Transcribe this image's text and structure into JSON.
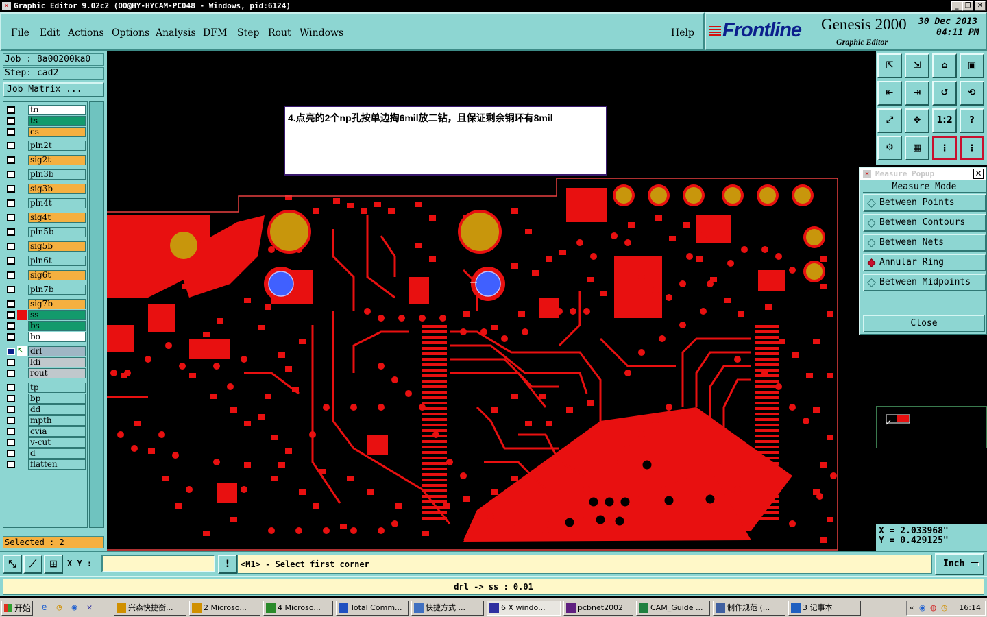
{
  "window": {
    "title": "Graphic Editor 9.02c2  (OO@HY-HYCAM-PC048 - Windows, pid:6124)"
  },
  "menu": {
    "file": "File",
    "edit": "Edit",
    "actions": "Actions",
    "options": "Options",
    "analysis": "Analysis",
    "dfm": "DFM",
    "step": "Step",
    "rout": "Rout",
    "windows": "Windows",
    "help": "Help"
  },
  "brand": {
    "logo": "Frontline",
    "product": "Genesis 2000",
    "subtitle": "Graphic Editor",
    "date_line1": "30  Dec  2013",
    "date_line2": "04:11  PM"
  },
  "left": {
    "job": "Job  :  8a00200ka0",
    "step": "Step:  cad2",
    "job_matrix": "Job Matrix ...",
    "selected": "Selected : 2"
  },
  "layers": [
    {
      "name": "to",
      "bg": "#ffffff",
      "swatch": ""
    },
    {
      "name": "ts",
      "bg": "#139a6c",
      "swatch": ""
    },
    {
      "name": "cs",
      "bg": "#f5b040",
      "swatch": ""
    },
    {
      "name": "pln2t",
      "bg": "#8dd6d2",
      "swatch": ""
    },
    {
      "name": "sig2t",
      "bg": "#f5b040",
      "swatch": ""
    },
    {
      "name": "pln3b",
      "bg": "#8dd6d2",
      "swatch": ""
    },
    {
      "name": "sig3b",
      "bg": "#f5b040",
      "swatch": ""
    },
    {
      "name": "pln4t",
      "bg": "#8dd6d2",
      "swatch": ""
    },
    {
      "name": "sig4t",
      "bg": "#f5b040",
      "swatch": ""
    },
    {
      "name": "pln5b",
      "bg": "#8dd6d2",
      "swatch": ""
    },
    {
      "name": "sig5b",
      "bg": "#f5b040",
      "swatch": ""
    },
    {
      "name": "pln6t",
      "bg": "#8dd6d2",
      "swatch": ""
    },
    {
      "name": "sig6t",
      "bg": "#f5b040",
      "swatch": ""
    },
    {
      "name": "pln7b",
      "bg": "#8dd6d2",
      "swatch": ""
    },
    {
      "name": "sig7b",
      "bg": "#f5b040",
      "swatch": ""
    },
    {
      "name": "ss",
      "bg": "#139a6c",
      "swatch": "#e81010"
    },
    {
      "name": "bs",
      "bg": "#139a6c",
      "swatch": ""
    },
    {
      "name": "bo",
      "bg": "#ffffff",
      "swatch": ""
    },
    {
      "name": "drl",
      "bg": "#9fb6c4",
      "swatch": "",
      "active": true
    },
    {
      "name": "ldi",
      "bg": "#c0c8cc",
      "swatch": ""
    },
    {
      "name": "rout",
      "bg": "#c0c8cc",
      "swatch": ""
    },
    {
      "name": "tp",
      "bg": "#8dd6d2",
      "swatch": ""
    },
    {
      "name": "bp",
      "bg": "#8dd6d2",
      "swatch": ""
    },
    {
      "name": "dd",
      "bg": "#8dd6d2",
      "swatch": ""
    },
    {
      "name": "mpth",
      "bg": "#8dd6d2",
      "swatch": ""
    },
    {
      "name": "cvia",
      "bg": "#8dd6d2",
      "swatch": ""
    },
    {
      "name": "v-cut",
      "bg": "#8dd6d2",
      "swatch": ""
    },
    {
      "name": "d",
      "bg": "#8dd6d2",
      "swatch": ""
    },
    {
      "name": "flatten",
      "bg": "#8dd6d2",
      "swatch": ""
    }
  ],
  "note": {
    "text": "4.点亮的2个np孔按单边掏6mil放二钻，且保证剩余铜环有8mil"
  },
  "measure": {
    "title": "Measure Popup",
    "mode_label": "Measure Mode",
    "options": [
      "Between Points",
      "Between Contours",
      "Between Nets",
      "Annular Ring",
      "Between Midpoints"
    ],
    "selected": "Annular Ring",
    "close": "Close"
  },
  "toolbar_icons": {
    "ratio": "1:2",
    "help": "?"
  },
  "coords": {
    "x": "X  =  2.033968\"",
    "y": "Y  =  0.429125\""
  },
  "bottom": {
    "xy_label": "X Y :",
    "xy_value": "",
    "prompt": "<M1> - Select first corner",
    "unit": "Inch",
    "status": "drl -> ss : 0.01"
  },
  "taskbar": {
    "start": "开始",
    "tasks": [
      "兴森快捷衡...",
      "2 Microso...",
      "4 Microso...",
      "Total Comm...",
      "快捷方式 ...",
      "6 X windo...",
      "pcbnet2002",
      "CAM_Guide ...",
      "制作规范 (...",
      "3 记事本"
    ],
    "clock": "16:14"
  },
  "colors": {
    "panel": "#8dd6d2",
    "copper": "#e81010",
    "pad_gold": "#c8960c",
    "drill_blue": "#4060ff",
    "brand_blue": "#0b1f8c"
  }
}
